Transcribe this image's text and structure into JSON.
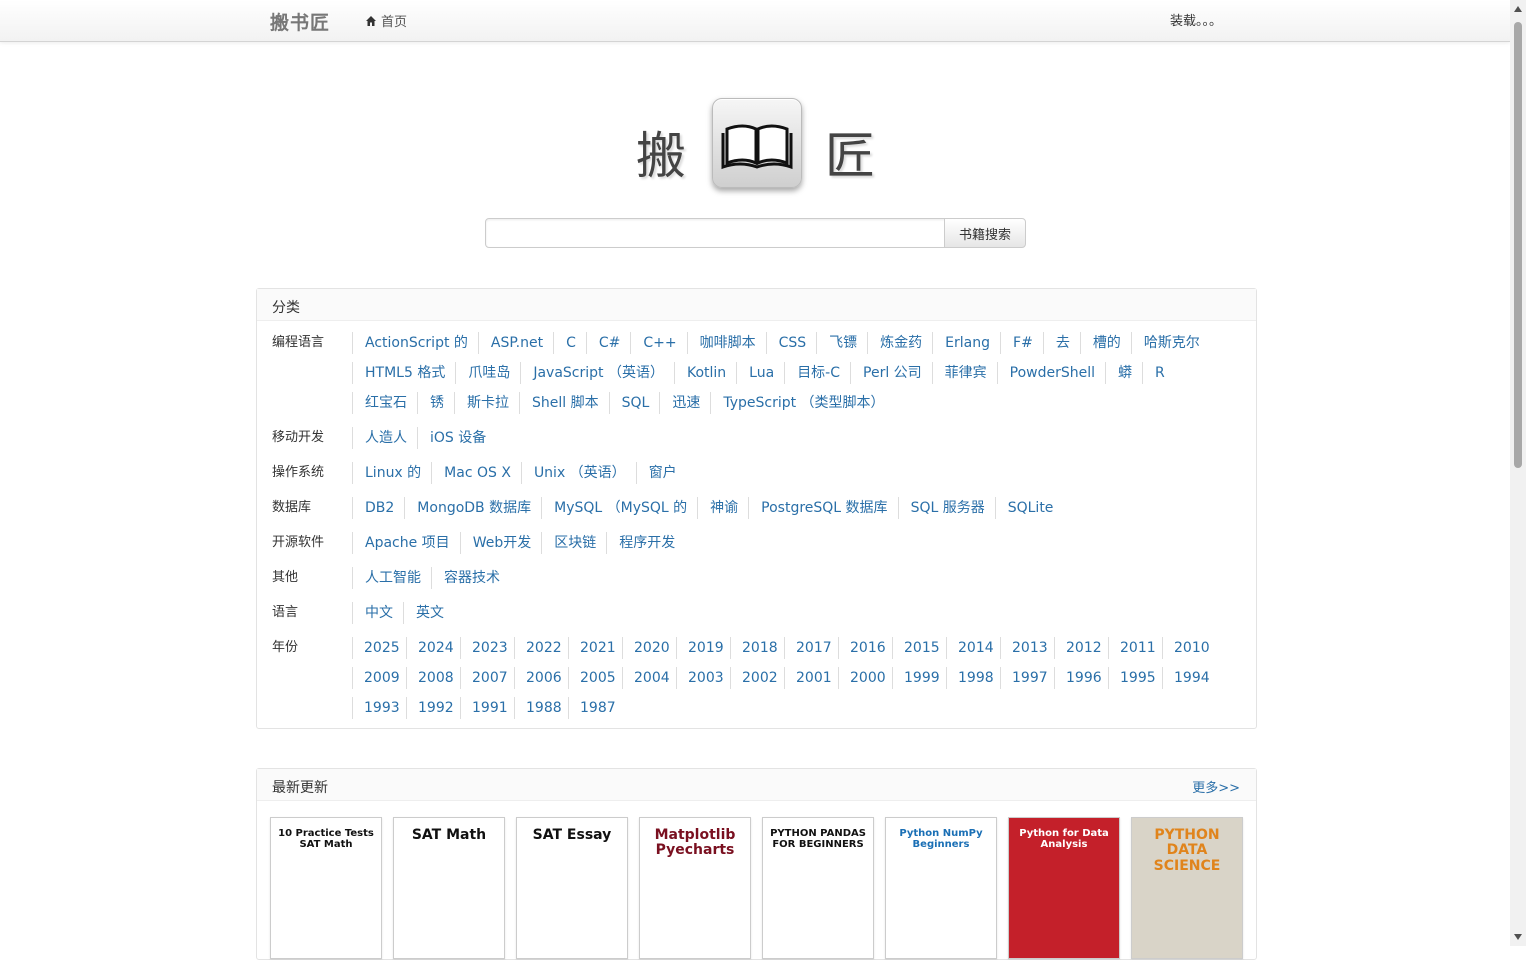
{
  "navbar": {
    "brand": "搬书匠",
    "home": "首页",
    "loading": "装载。。。"
  },
  "logo": {
    "left_char": "搬",
    "right_char": "匠",
    "icon": "open-book-icon"
  },
  "search": {
    "value": "",
    "button": "书籍搜索"
  },
  "categories": {
    "title": "分类",
    "rows": [
      {
        "label": "编程语言",
        "items": [
          "ActionScript 的",
          "ASP.net",
          "C",
          "C#",
          "C++",
          "咖啡脚本",
          "CSS",
          "飞镖",
          "炼金药",
          "Erlang",
          "F#",
          "去",
          "槽的",
          "哈斯克尔",
          "HTML5 格式",
          "爪哇岛",
          "JavaScript （英语）",
          "Kotlin",
          "Lua",
          "目标-C",
          "Perl 公司",
          "菲律宾",
          "PowderShell",
          "蟒",
          "R",
          "红宝石",
          "锈",
          "斯卡拉",
          "Shell 脚本",
          "SQL",
          "迅速",
          "TypeScript （类型脚本）"
        ]
      },
      {
        "label": "移动开发",
        "items": [
          "人造人",
          "iOS 设备"
        ]
      },
      {
        "label": "操作系统",
        "items": [
          "Linux 的",
          "Mac OS X",
          "Unix （英语）",
          "窗户"
        ]
      },
      {
        "label": "数据库",
        "items": [
          "DB2",
          "MongoDB 数据库",
          "MySQL （MySQL 的",
          "神谕",
          "PostgreSQL 数据库",
          "SQL 服务器",
          "SQLite"
        ]
      },
      {
        "label": "开源软件",
        "items": [
          "Apache 项目",
          "Web开发",
          "区块链",
          "程序开发"
        ]
      },
      {
        "label": "其他",
        "items": [
          "人工智能",
          "容器技术"
        ]
      },
      {
        "label": "语言",
        "items": [
          "中文",
          "英文"
        ]
      }
    ],
    "years_label": "年份",
    "years": [
      "2025",
      "2024",
      "2023",
      "2022",
      "2021",
      "2020",
      "2019",
      "2018",
      "2017",
      "2016",
      "2015",
      "2014",
      "2013",
      "2012",
      "2011",
      "2010",
      "2009",
      "2008",
      "2007",
      "2006",
      "2005",
      "2004",
      "2003",
      "2002",
      "2001",
      "2000",
      "1999",
      "1998",
      "1997",
      "1996",
      "1995",
      "1994",
      "1993",
      "1992",
      "1991",
      "1988",
      "1987"
    ]
  },
  "latest": {
    "title": "最新更新",
    "more": "更多>>",
    "books": [
      {
        "title": "10 Practice Tests SAT Math",
        "bg": "#ffffff",
        "fg": "#111111"
      },
      {
        "title": "SAT Math",
        "bg": "#ffffff",
        "fg": "#111111"
      },
      {
        "title": "SAT Essay",
        "bg": "#ffffff",
        "fg": "#111111"
      },
      {
        "title": "Matplotlib Pyecharts",
        "bg": "#ffffff",
        "fg": "#7a1020"
      },
      {
        "title": "PYTHON PANDAS FOR BEGINNERS",
        "bg": "#ffffff",
        "fg": "#111111"
      },
      {
        "title": "Python NumPy Beginners",
        "bg": "#ffffff",
        "fg": "#1a6fb5"
      },
      {
        "title": "Python for Data Analysis",
        "bg": "#c4202a",
        "fg": "#ffffff"
      },
      {
        "title": "PYTHON DATA SCIENCE",
        "bg": "#d9d4c8",
        "fg": "#e0841c"
      }
    ]
  },
  "colors": {
    "link": "#2a6fa8",
    "navbar_bg": "#f5f5f5"
  }
}
